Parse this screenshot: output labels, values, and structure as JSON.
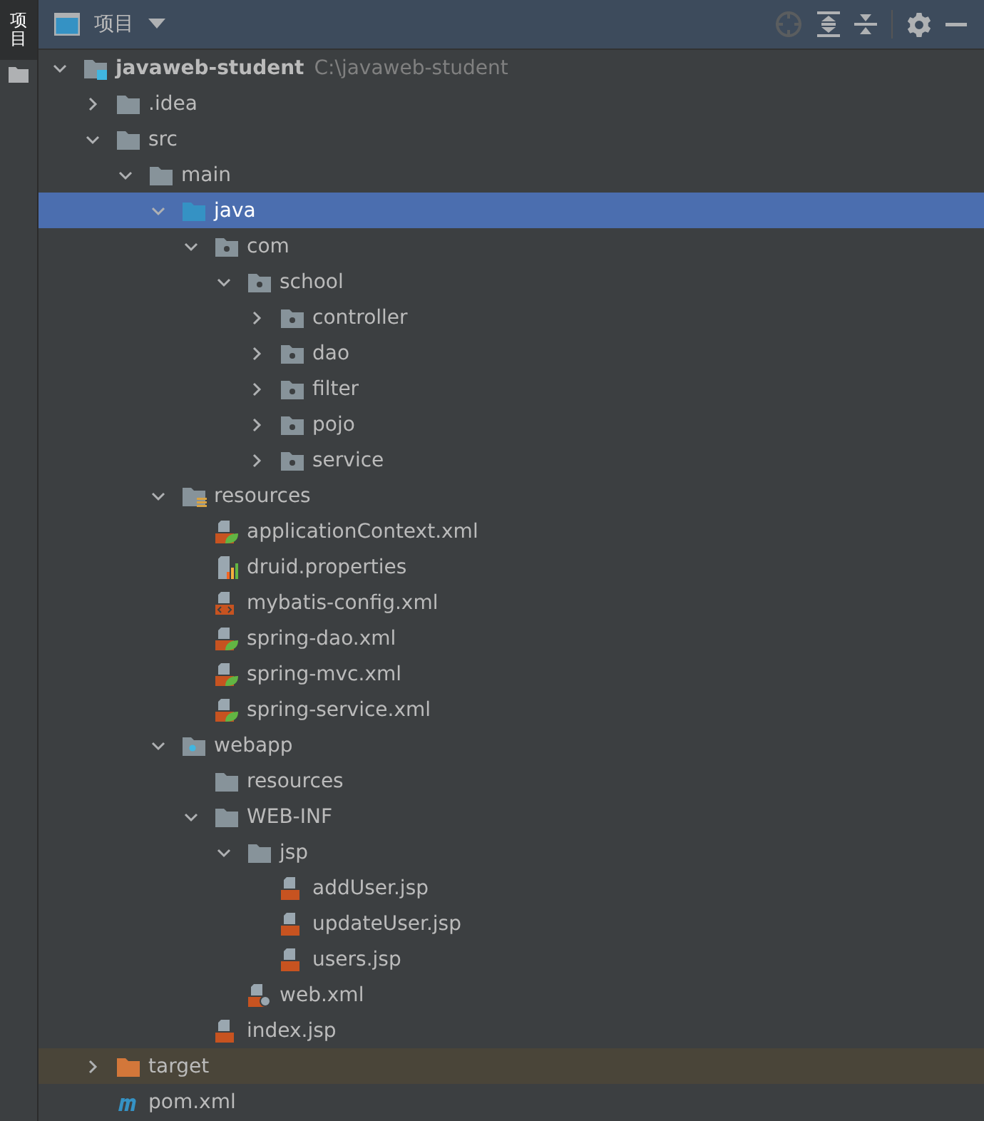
{
  "side_tab": {
    "label": "项目",
    "selected": true
  },
  "header": {
    "title": "项目"
  },
  "tree": [
    {
      "name": "javaweb-student",
      "path": "C:\\javaweb-student",
      "kind": "module",
      "expanded": true,
      "selected": false,
      "children": [
        {
          "name": ".idea",
          "kind": "folder",
          "expanded": false,
          "selected": false
        },
        {
          "name": "src",
          "kind": "folder",
          "expanded": true,
          "selected": false,
          "children": [
            {
              "name": "main",
              "kind": "folder",
              "expanded": true,
              "selected": false,
              "children": [
                {
                  "name": "java",
                  "kind": "source",
                  "expanded": true,
                  "selected": true,
                  "children": [
                    {
                      "name": "com",
                      "kind": "package",
                      "expanded": true,
                      "selected": false,
                      "children": [
                        {
                          "name": "school",
                          "kind": "package",
                          "expanded": true,
                          "selected": false,
                          "children": [
                            {
                              "name": "controller",
                              "kind": "package",
                              "expanded": false,
                              "selected": false
                            },
                            {
                              "name": "dao",
                              "kind": "package",
                              "expanded": false,
                              "selected": false
                            },
                            {
                              "name": "filter",
                              "kind": "package",
                              "expanded": false,
                              "selected": false
                            },
                            {
                              "name": "pojo",
                              "kind": "package",
                              "expanded": false,
                              "selected": false
                            },
                            {
                              "name": "service",
                              "kind": "package",
                              "expanded": false,
                              "selected": false
                            }
                          ]
                        }
                      ]
                    }
                  ]
                },
                {
                  "name": "resources",
                  "kind": "resources",
                  "expanded": true,
                  "selected": false,
                  "children": [
                    {
                      "name": "applicationContext.xml",
                      "kind": "spring",
                      "selected": false
                    },
                    {
                      "name": "druid.properties",
                      "kind": "properties",
                      "selected": false
                    },
                    {
                      "name": "mybatis-config.xml",
                      "kind": "xml",
                      "selected": false
                    },
                    {
                      "name": "spring-dao.xml",
                      "kind": "spring",
                      "selected": false
                    },
                    {
                      "name": "spring-mvc.xml",
                      "kind": "spring",
                      "selected": false
                    },
                    {
                      "name": "spring-service.xml",
                      "kind": "spring",
                      "selected": false
                    }
                  ]
                },
                {
                  "name": "webapp",
                  "kind": "web",
                  "expanded": true,
                  "selected": false,
                  "children": [
                    {
                      "name": "resources",
                      "kind": "folder",
                      "selected": false
                    },
                    {
                      "name": "WEB-INF",
                      "kind": "folder",
                      "expanded": true,
                      "selected": false,
                      "children": [
                        {
                          "name": "jsp",
                          "kind": "folder",
                          "expanded": true,
                          "selected": false,
                          "children": [
                            {
                              "name": "addUser.jsp",
                              "kind": "jsp",
                              "selected": false
                            },
                            {
                              "name": "updateUser.jsp",
                              "kind": "jsp",
                              "selected": false
                            },
                            {
                              "name": "users.jsp",
                              "kind": "jsp",
                              "selected": false
                            }
                          ]
                        },
                        {
                          "name": "web.xml",
                          "kind": "webxml",
                          "selected": false
                        }
                      ]
                    },
                    {
                      "name": "index.jsp",
                      "kind": "jsp",
                      "selected": false
                    }
                  ]
                }
              ]
            }
          ]
        },
        {
          "name": "target",
          "kind": "excluded",
          "expanded": false,
          "selected": false
        },
        {
          "name": "pom.xml",
          "kind": "maven",
          "selected": false
        }
      ]
    }
  ]
}
